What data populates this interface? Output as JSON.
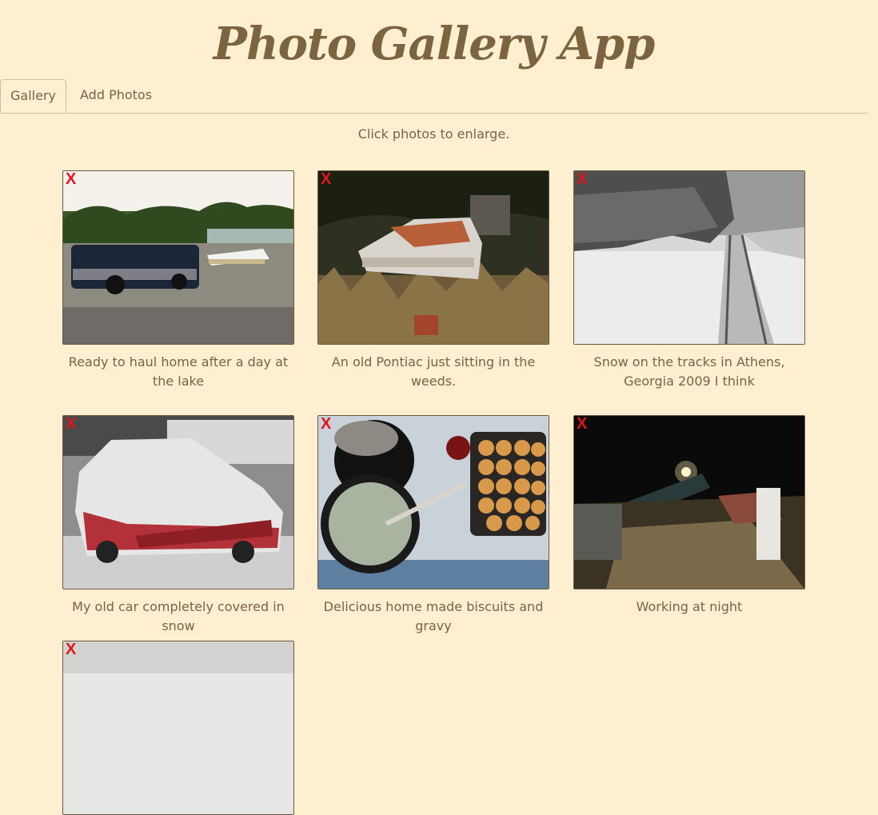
{
  "app": {
    "title": "Photo Gallery App"
  },
  "tabs": [
    {
      "label": "Gallery",
      "active": true
    },
    {
      "label": "Add Photos",
      "active": false
    }
  ],
  "gallery": {
    "hint": "Click photos to enlarge.",
    "delete_label": "X",
    "photos": [
      {
        "caption": "Ready to haul home after a day at the lake"
      },
      {
        "caption": "An old Pontiac just sitting in the weeds."
      },
      {
        "caption": "Snow on the tracks in Athens, Georgia 2009 I think"
      },
      {
        "caption": "My old car completely covered in snow"
      },
      {
        "caption": "Delicious home made biscuits and gravy"
      },
      {
        "caption": "Working at night"
      },
      {
        "caption": ""
      }
    ]
  },
  "colors": {
    "background": "#fdefcf",
    "text": "#7a6443",
    "delete": "#e4141a"
  }
}
